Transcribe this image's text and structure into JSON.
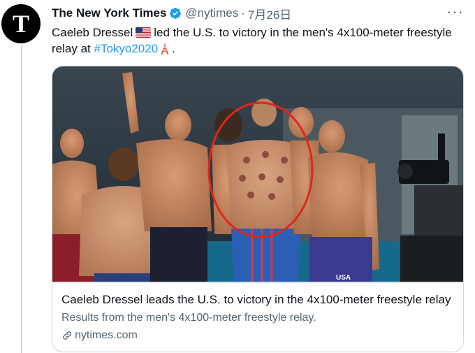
{
  "tweet": {
    "avatar_letter": "T",
    "author_name": "The New York Times",
    "handle": "@nytimes",
    "separator": "·",
    "date": "7月26日",
    "more_label": "···",
    "text_part1": "Caeleb Dressel",
    "text_part2": "led the U.S. to victory in the men's 4x100-meter freestyle relay at",
    "hashtag": "#Tokyo2020",
    "text_end": ".",
    "flag_emoji": "us-flag",
    "tower_emoji": "tokyo-tower"
  },
  "card": {
    "image_subject": "Team USA swimmers celebrating in the pool, swimmer with cupping marks circled in red",
    "usa_text": "USA",
    "title": "Caeleb Dressel leads the U.S. to victory in the 4x100-meter freestyle relay",
    "description": "Results from the men's 4x100-meter freestyle relay.",
    "domain": "nytimes.com"
  },
  "colors": {
    "link": "#1d9bf0",
    "secondary_text": "#536471",
    "border": "#cfd9de",
    "circle": "#e0261b"
  }
}
